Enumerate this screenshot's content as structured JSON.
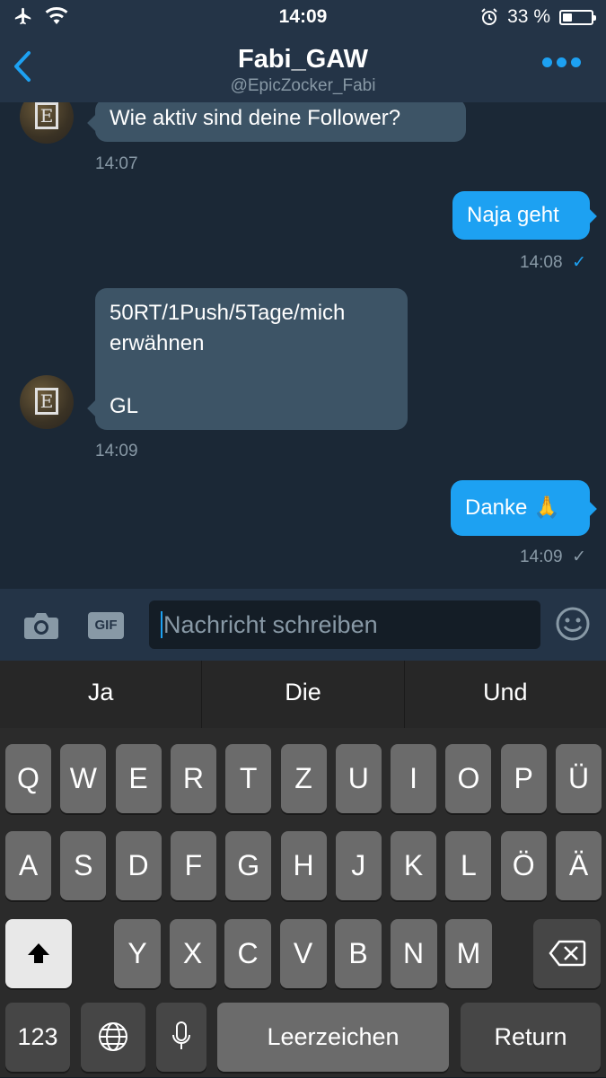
{
  "status": {
    "time": "14:09",
    "battery": "33 %",
    "battery_level": 0.33
  },
  "header": {
    "name": "Fabi_GAW",
    "handle": "@EpicZocker_Fabi"
  },
  "messages": [
    {
      "text": "Wie aktiv sind deine Follower?",
      "time": "14:07"
    },
    {
      "text": "Naja geht",
      "time": "14:08",
      "check": "✓"
    },
    {
      "line1": "50RT/1Push/5Tage/mich",
      "line2": "erwähnen",
      "line3": "GL",
      "time": "14:09"
    },
    {
      "text": "Danke 🙏",
      "time": "14:09",
      "check": "✓"
    }
  ],
  "composer": {
    "placeholder": "Nachricht schreiben",
    "gif_label": "GIF"
  },
  "keyboard": {
    "predictions": [
      "Ja",
      "Die",
      "Und"
    ],
    "row1": [
      "Q",
      "W",
      "E",
      "R",
      "T",
      "Z",
      "U",
      "I",
      "O",
      "P",
      "Ü"
    ],
    "row2": [
      "A",
      "S",
      "D",
      "F",
      "G",
      "H",
      "J",
      "K",
      "L",
      "Ö",
      "Ä"
    ],
    "row3": [
      "Y",
      "X",
      "C",
      "V",
      "B",
      "N",
      "M"
    ],
    "numbers": "123",
    "space": "Leerzeichen",
    "return": "Return"
  },
  "colors": {
    "accent": "#1da1f2",
    "incoming": "#3d5466",
    "background": "#1b2836"
  }
}
